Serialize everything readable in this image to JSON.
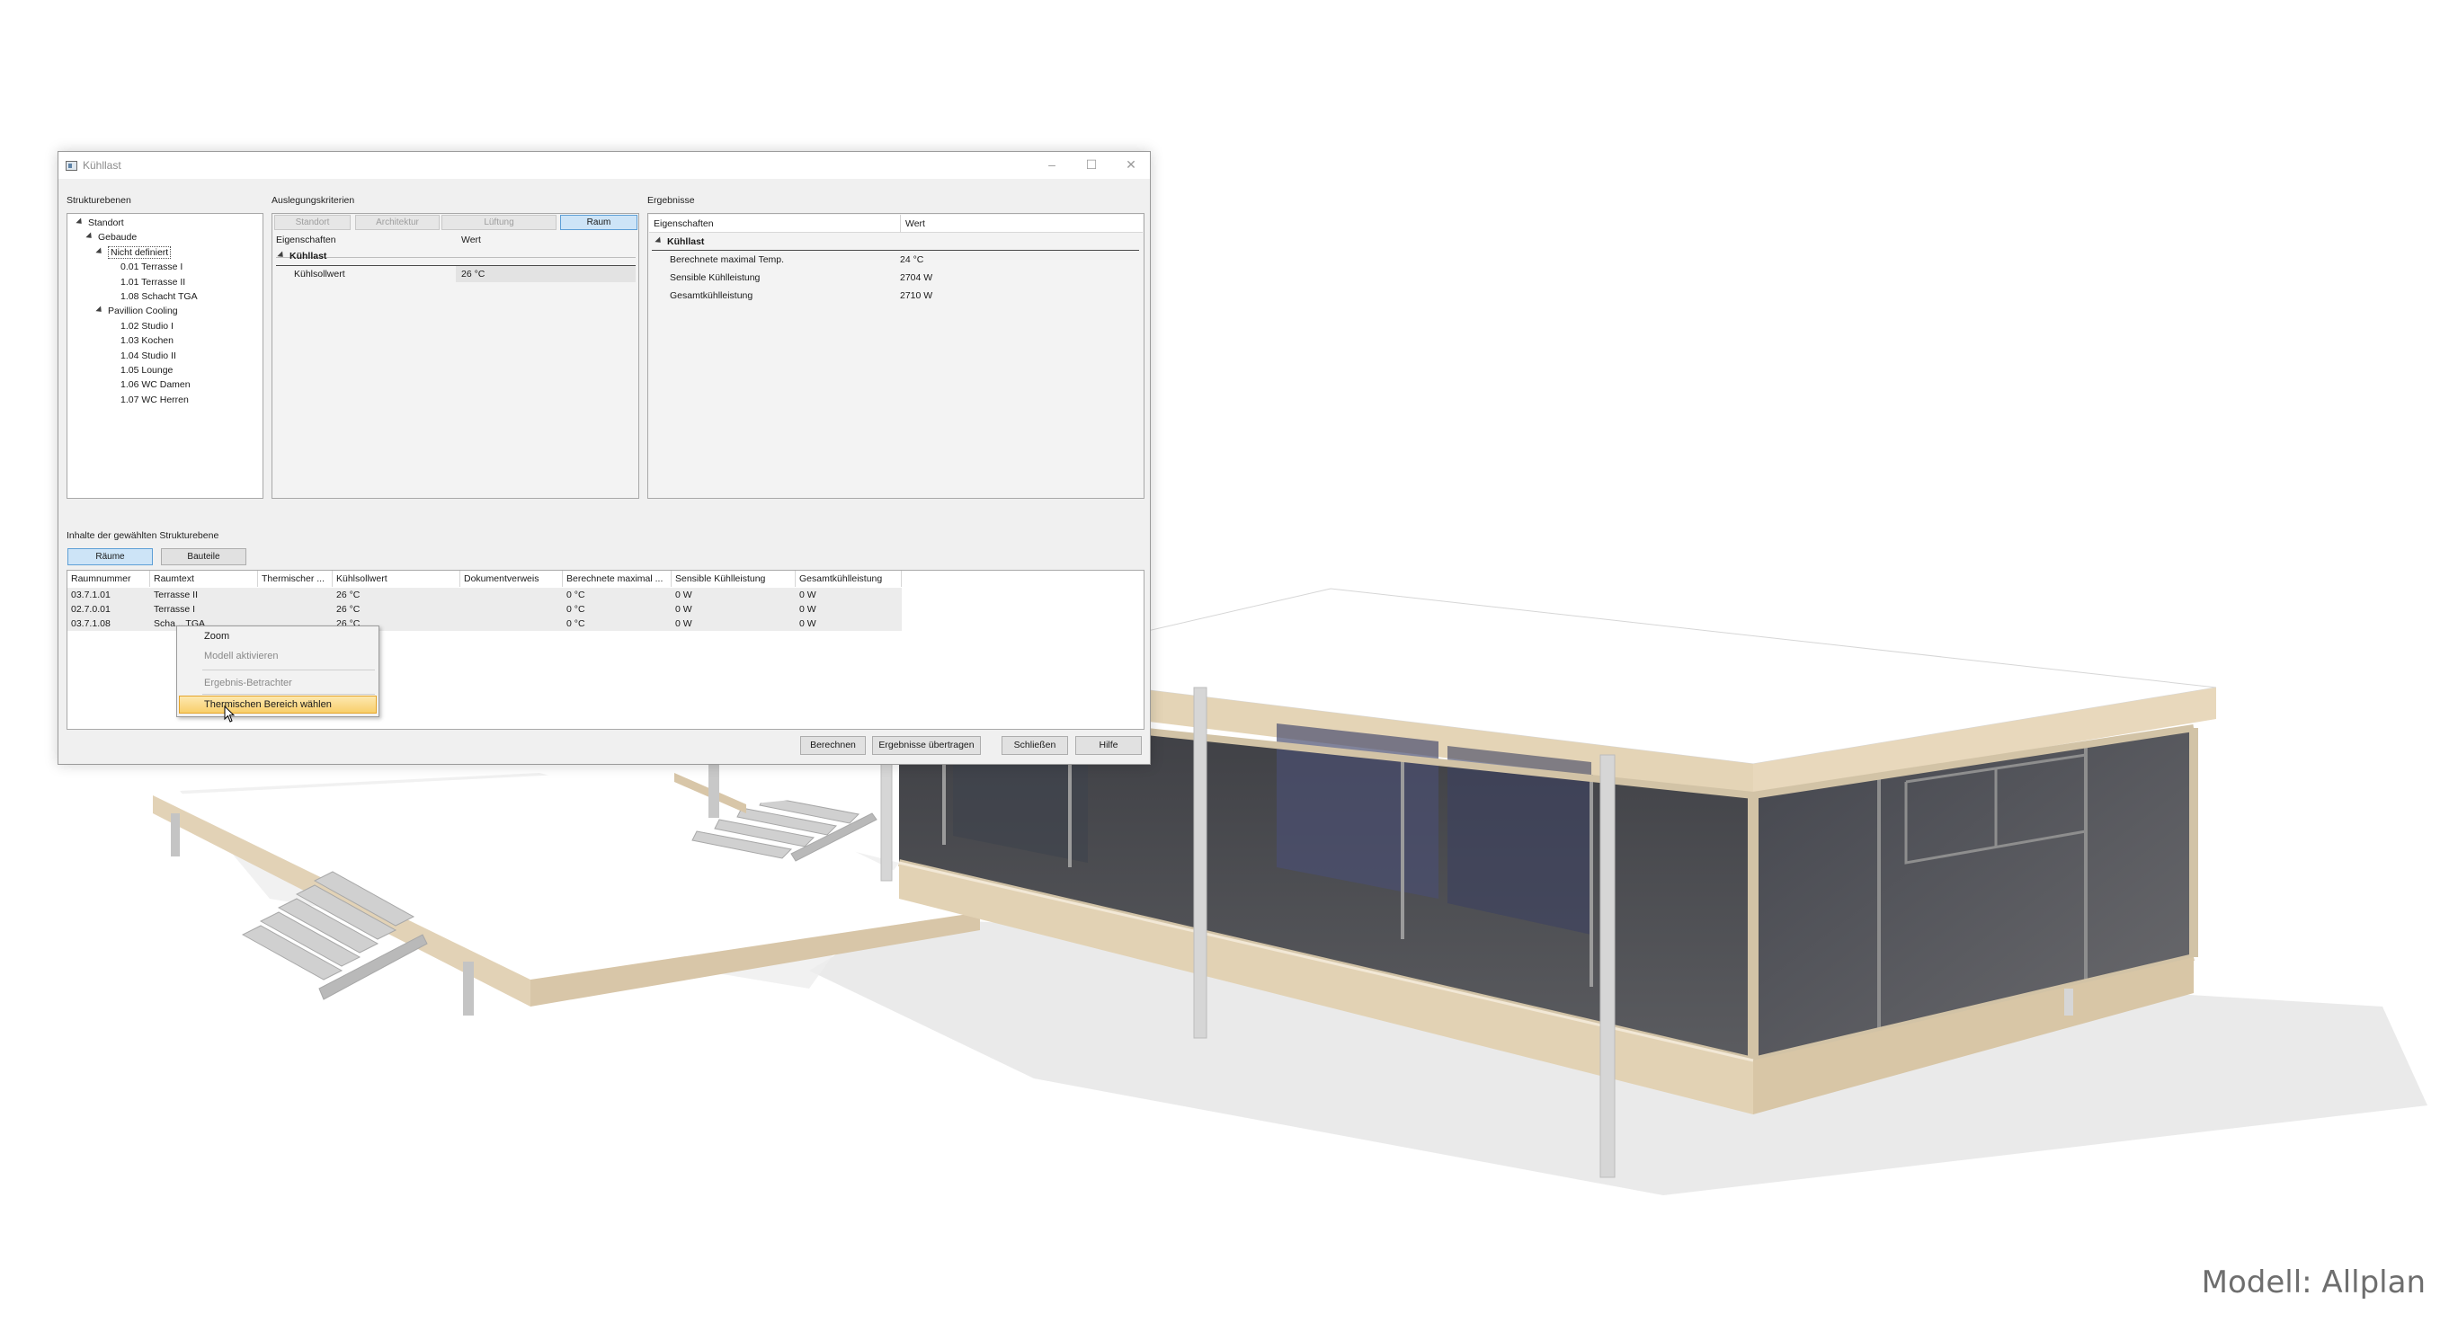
{
  "watermark": "Modell: Allplan",
  "window": {
    "title": "Kühllast"
  },
  "structure": {
    "label": "Strukturebenen",
    "items": [
      {
        "label": "Standort",
        "level": 0,
        "expanded": true
      },
      {
        "label": "Gebaude",
        "level": 1,
        "expanded": true
      },
      {
        "label": "Nicht definiert",
        "level": 2,
        "expanded": true,
        "selected": true
      },
      {
        "label": "0.01 Terrasse I",
        "level": 3
      },
      {
        "label": "1.01 Terrasse II",
        "level": 3
      },
      {
        "label": "1.08 Schacht TGA",
        "level": 3
      },
      {
        "label": "Pavillion Cooling",
        "level": 2,
        "expanded": true
      },
      {
        "label": "1.02 Studio I",
        "level": 3
      },
      {
        "label": "1.03 Kochen",
        "level": 3
      },
      {
        "label": "1.04 Studio II",
        "level": 3
      },
      {
        "label": "1.05 Lounge",
        "level": 3
      },
      {
        "label": "1.06 WC Damen",
        "level": 3
      },
      {
        "label": "1.07 WC Herren",
        "level": 3
      }
    ]
  },
  "criteria": {
    "label": "Auslegungskriterien",
    "tabs": [
      {
        "label": "Standort",
        "state": "disabled"
      },
      {
        "label": "Architektur",
        "state": "disabled"
      },
      {
        "label": "Lüftung",
        "state": "disabled"
      },
      {
        "label": "Raum",
        "state": "active"
      }
    ],
    "col_property": "Eigenschaften",
    "col_value": "Wert",
    "category": "Kühllast",
    "rows": [
      {
        "name": "Kühlsollwert",
        "value": "26 °C"
      }
    ]
  },
  "results": {
    "label": "Ergebnisse",
    "col_property": "Eigenschaften",
    "col_value": "Wert",
    "category": "Kühllast",
    "rows": [
      {
        "name": "Berechnete maximal Temp.",
        "value": "24 °C"
      },
      {
        "name": "Sensible Kühlleistung",
        "value": "2704 W"
      },
      {
        "name": "Gesamtkühlleistung",
        "value": "2710 W"
      }
    ]
  },
  "contents": {
    "label": "Inhalte der gewählten Strukturebene",
    "tabs": [
      {
        "label": "Räume",
        "state": "active"
      },
      {
        "label": "Bauteile",
        "state": "normal"
      }
    ],
    "columns": [
      "Raumnummer",
      "Raumtext",
      "Thermischer ...",
      "Kühlsollwert",
      "Dokumentverweis",
      "Berechnete maximal ...",
      "Sensible Kühlleistung",
      "Gesamtkühlleistung"
    ],
    "rows": [
      [
        "03.7.1.01",
        "Terrasse II",
        "",
        "26 °C",
        "",
        "0 °C",
        "0 W",
        "0 W"
      ],
      [
        "02.7.0.01",
        "Terrasse I",
        "",
        "26 °C",
        "",
        "0 °C",
        "0 W",
        "0 W"
      ],
      [
        "03.7.1.08",
        "Scha... TGA",
        "",
        "26 °C",
        "",
        "0 °C",
        "0 W",
        "0 W"
      ]
    ]
  },
  "context_menu": {
    "items": [
      {
        "label": "Zoom",
        "enabled": true
      },
      {
        "label": "Modell aktivieren",
        "enabled": false
      },
      {
        "label": "Ergebnis-Betrachter",
        "enabled": false
      },
      {
        "label": "Thermischen Bereich wählen",
        "enabled": true,
        "highlighted": true
      }
    ]
  },
  "buttons": {
    "calculate": "Berechnen",
    "transfer": "Ergebnisse übertragen",
    "close": "Schließen",
    "help": "Hilfe"
  }
}
